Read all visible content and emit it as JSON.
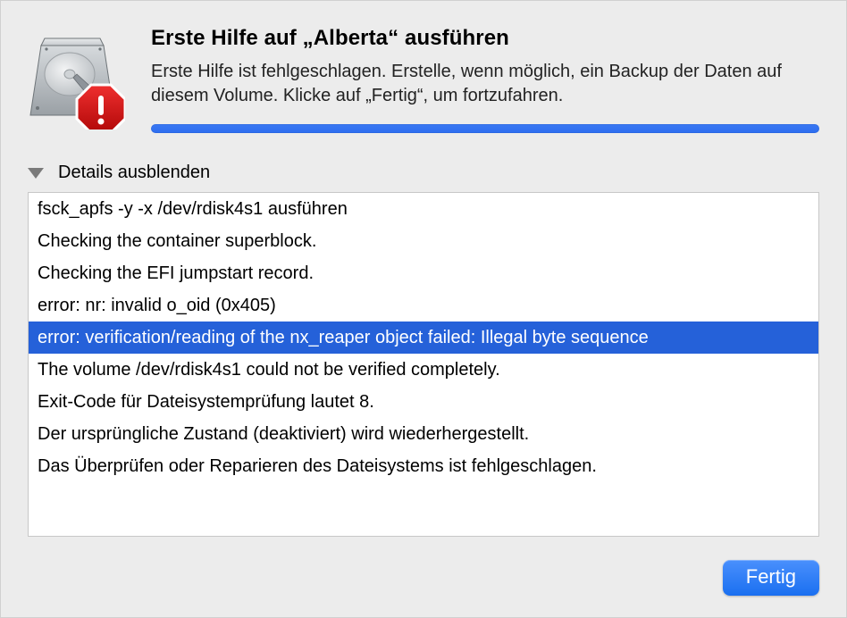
{
  "title": "Erste Hilfe auf „Alberta“ ausführen",
  "message": "Erste Hilfe ist fehlgeschlagen. Erstelle, wenn möglich, ein Backup der Daten auf diesem Volume. Klicke auf „Fertig“, um fortzufahren.",
  "progress_percent": 100,
  "details_toggle_label": "Details ausblenden",
  "log_lines": [
    {
      "text": "fsck_apfs -y -x /dev/rdisk4s1 ausführen",
      "selected": false
    },
    {
      "text": "Checking the container superblock.",
      "selected": false
    },
    {
      "text": "Checking the EFI jumpstart record.",
      "selected": false
    },
    {
      "text": "error: nr: invalid o_oid (0x405)",
      "selected": false
    },
    {
      "text": "error: verification/reading of the nx_reaper object failed: Illegal byte sequence",
      "selected": true
    },
    {
      "text": "The volume /dev/rdisk4s1 could not be verified completely.",
      "selected": false
    },
    {
      "text": "Exit-Code für Dateisystemprüfung lautet 8.",
      "selected": false
    },
    {
      "text": "Der ursprüngliche Zustand (deaktiviert) wird wiederhergestellt.",
      "selected": false
    },
    {
      "text": "Das Überprüfen oder Reparieren des Dateisystems ist fehlgeschlagen.",
      "selected": false
    }
  ],
  "done_button_label": "Fertig",
  "colors": {
    "accent": "#2d6df0",
    "selection": "#2561d9"
  }
}
